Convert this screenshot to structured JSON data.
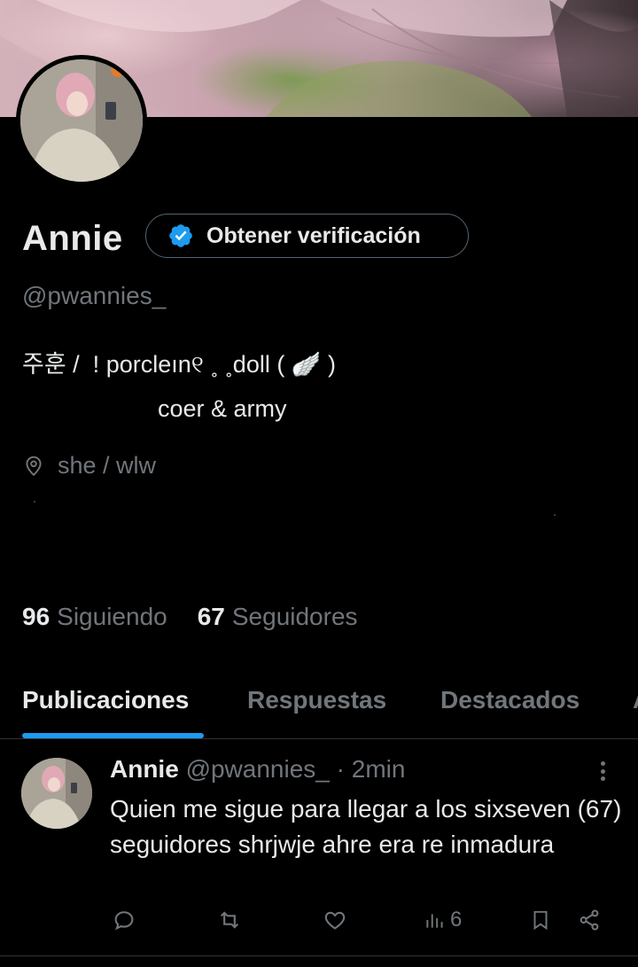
{
  "profile": {
    "display_name": "Annie",
    "verify_button_label": "Obtener verificación",
    "handle": "@pwannies_",
    "bio_line1": "주훈 /  ! porcleın୧ ˳ ˳doll ( 🪽 )",
    "bio_line2": "coer & army",
    "location": "she / wlw"
  },
  "stats": {
    "following_count": "96",
    "following_label": "Siguiendo",
    "followers_count": "67",
    "followers_label": "Seguidores"
  },
  "tabs": {
    "items": [
      "Publicaciones",
      "Respuestas",
      "Destacados",
      "A"
    ],
    "active": "Publicaciones"
  },
  "post": {
    "author_name": "Annie",
    "author_handle": "@pwannies_",
    "time": "· 2min",
    "text": "Quien me sigue para llegar a los sixseven (67) seguidores shrjwje ahre era re inmadura",
    "views": "6"
  },
  "colors": {
    "background": "#000000",
    "text_primary": "#e7e9ea",
    "text_secondary": "#71767b",
    "accent": "#1d9bf0",
    "border": "#2f3336"
  },
  "icons": [
    "verified-badge-icon",
    "location-pin-icon",
    "more-options-icon",
    "reply-icon",
    "retweet-icon",
    "like-icon",
    "views-icon",
    "bookmark-icon",
    "share-icon"
  ]
}
